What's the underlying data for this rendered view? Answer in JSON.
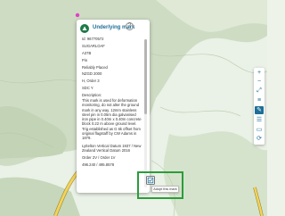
{
  "popup": {
    "title": "Underlying mark",
    "help_icon": "?",
    "icon": "survey-mark-icon",
    "fields": [
      "Id: 96770572",
      "SUGARLOAF",
      "A37B",
      "Pin",
      "Reliably Placed",
      "NZGD 2000",
      "H, Order 3",
      "SDC Y",
      "Description:"
    ],
    "description": "This mark is used for deformation monitoring, do not alter the ground mark in any way. 12mm stainless steel pin in 0.05m dia galvanised iron pipe in 0.40m x 0.40m concrete block 0.22 m above ground level. Trig established as G 6k offset from original flagstaff by CW Adams in 1879.",
    "extra_fields": [
      "Lyttelton Vertical Datum 1937 / New Zealand Vertical Datum 2016",
      "Order 2V / Order 1V",
      "496.240 / 495.8578"
    ]
  },
  "toolbar": {
    "buttons": [
      {
        "icon": "plus-icon",
        "glyph": "+",
        "active": false
      },
      {
        "icon": "minus-icon",
        "glyph": "−",
        "active": false
      },
      {
        "icon": "expand-icon",
        "glyph": "⤢",
        "active": false
      },
      {
        "icon": "layers-icon",
        "glyph": "≡",
        "active": false
      },
      {
        "icon": "edit-pencil-icon",
        "glyph": "✎",
        "active": true
      },
      {
        "icon": "list-icon",
        "glyph": "☰",
        "active": false
      },
      {
        "icon": "bookmark-icon",
        "glyph": "▭",
        "active": false
      },
      {
        "icon": "refresh-icon",
        "glyph": "⟳",
        "active": false
      }
    ]
  },
  "tooltip": {
    "label": "Adopt this mark"
  },
  "colors": {
    "accent": "#1d6f96",
    "highlight": "#2a9d3a",
    "terrain": "#c9d8be",
    "road": "#f3d35a",
    "marker": "#e040c8"
  }
}
